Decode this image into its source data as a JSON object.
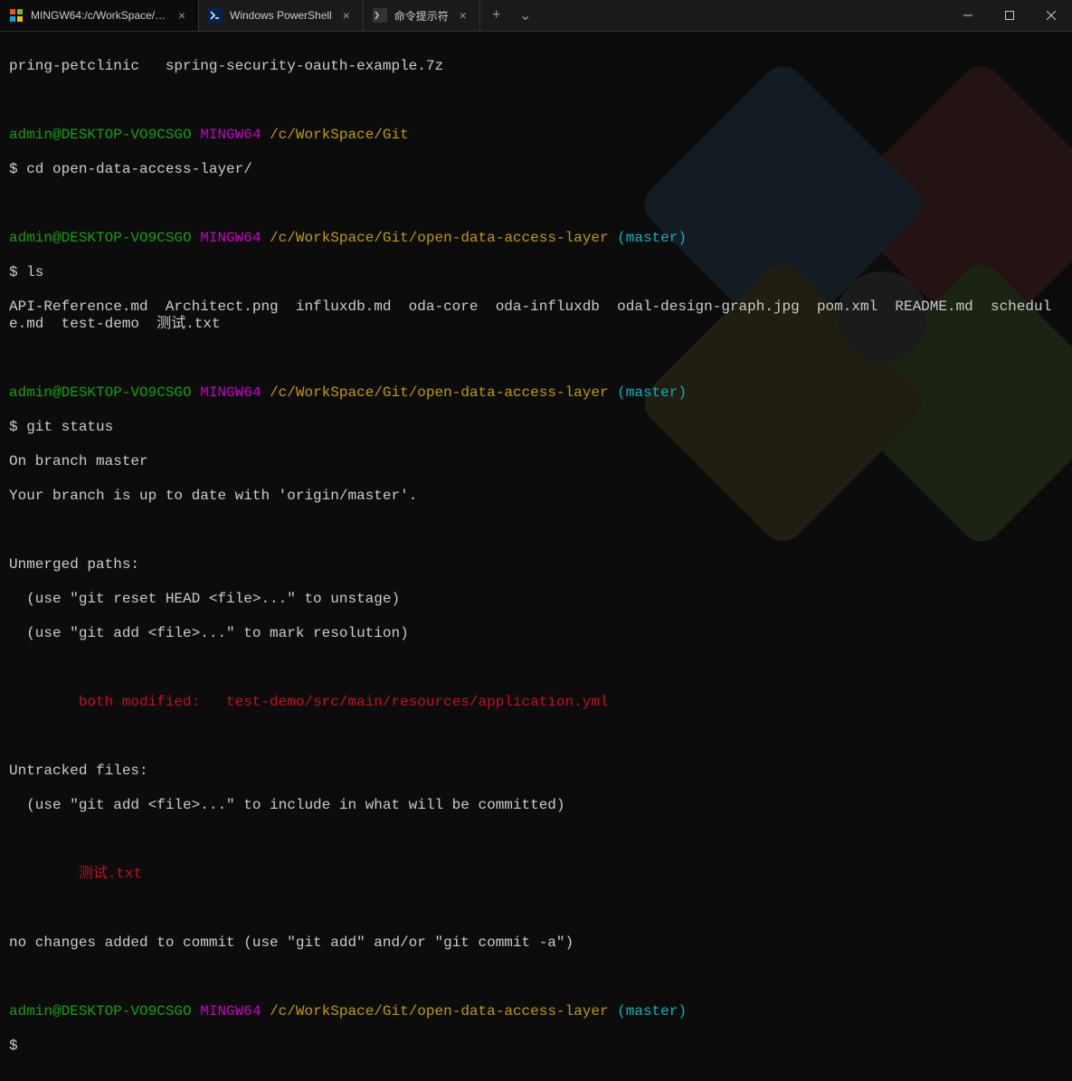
{
  "tabs": [
    {
      "title": "MINGW64:/c/WorkSpace/Git/op",
      "active": true
    },
    {
      "title": "Windows PowerShell",
      "active": false
    },
    {
      "title": "命令提示符",
      "active": false
    }
  ],
  "terminal": {
    "l0": "pring-petclinic   spring-security-oauth-example.7z",
    "p1": {
      "user": "admin@DESKTOP-VO9CSGO",
      "shell": "MINGW64",
      "path": "/c/WorkSpace/Git"
    },
    "cmd1": "$ cd open-data-access-layer/",
    "p2": {
      "user": "admin@DESKTOP-VO9CSGO",
      "shell": "MINGW64",
      "path": "/c/WorkSpace/Git/open-data-access-layer",
      "branch": "master"
    },
    "cmd2": "$ ls",
    "ls_out": "API-Reference.md  Architect.png  influxdb.md  oda-core  oda-influxdb  odal-design-graph.jpg  pom.xml  README.md  schedule.md  test-demo  测试.txt",
    "p3": {
      "user": "admin@DESKTOP-VO9CSGO",
      "shell": "MINGW64",
      "path": "/c/WorkSpace/Git/open-data-access-layer",
      "branch": "master"
    },
    "cmd3": "$ git status",
    "gs1": "On branch master",
    "gs2": "Your branch is up to date with 'origin/master'.",
    "gs3": "Unmerged paths:",
    "gs4": "  (use \"git reset HEAD <file>...\" to unstage)",
    "gs5": "  (use \"git add <file>...\" to mark resolution)",
    "gs6a": "        both modified:   ",
    "gs6b": "test-demo/src/main/resources/application.yml",
    "gs7": "Untracked files:",
    "gs8": "  (use \"git add <file>...\" to include in what will be committed)",
    "gs9": "        测试.txt",
    "gs10": "no changes added to commit (use \"git add\" and/or \"git commit -a\")",
    "p4": {
      "user": "admin@DESKTOP-VO9CSGO",
      "shell": "MINGW64",
      "path": "/c/WorkSpace/Git/open-data-access-layer",
      "branch": "master"
    },
    "cmd4": "$",
    "paren_open": " (",
    "paren_close": ")"
  }
}
